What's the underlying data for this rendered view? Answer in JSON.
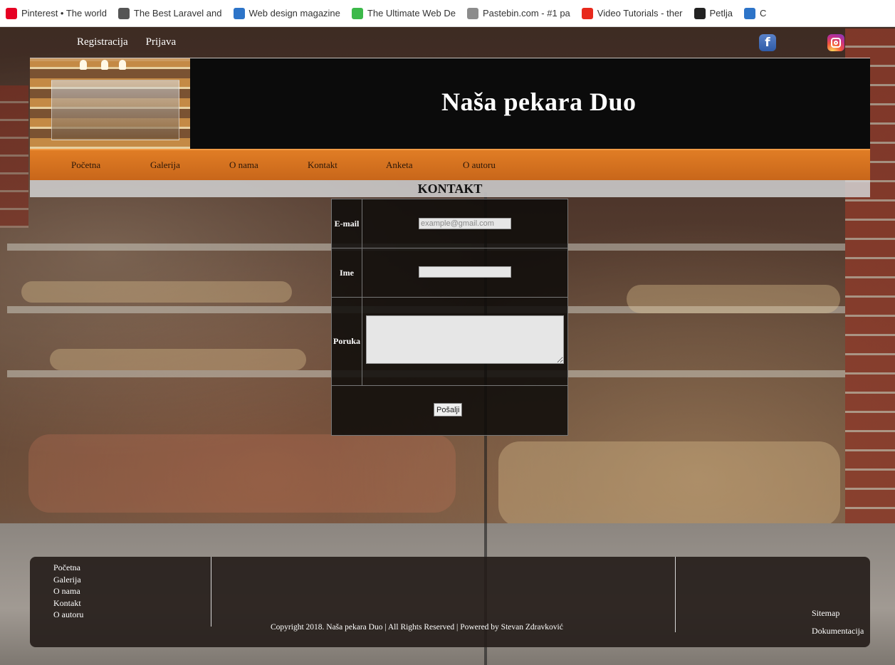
{
  "bookmarks": [
    {
      "label": "Pinterest • The world",
      "icon": "pinterest-icon",
      "color": "#e60023"
    },
    {
      "label": "The Best Laravel and",
      "icon": "laravel-icon",
      "color": "#555555"
    },
    {
      "label": "Web design magazine",
      "icon": "webdesign-icon",
      "color": "#2d74c8"
    },
    {
      "label": "The Ultimate Web De",
      "icon": "udemy-icon",
      "color": "#3cb94a"
    },
    {
      "label": "Pastebin.com - #1 pa",
      "icon": "pastebin-icon",
      "color": "#8c8c8c"
    },
    {
      "label": "Video Tutorials - ther",
      "icon": "video-tutorials-icon",
      "color": "#e8291c"
    },
    {
      "label": "Petlja",
      "icon": "petlja-icon",
      "color": "#222222"
    },
    {
      "label": "C",
      "icon": "bookmark-icon",
      "color": "#2d74c8"
    }
  ],
  "header": {
    "register": "Registracija",
    "login": "Prijava"
  },
  "banner": {
    "title": "Naša pekara Duo"
  },
  "nav": {
    "items": [
      "Početna",
      "Galerija",
      "O nama",
      "Kontakt",
      "Anketa",
      "O autoru"
    ]
  },
  "section": {
    "title": "KONTAKT"
  },
  "form": {
    "email_label": "E-mail",
    "email_placeholder": "example@gmail.com",
    "name_label": "Ime",
    "name_value": "",
    "message_label": "Poruka",
    "submit": "Pošalji"
  },
  "footer": {
    "links": [
      "Početna",
      "Galerija",
      "O nama",
      "Kontakt",
      "O autoru"
    ],
    "copyright": "Copyright 2018. Naša pekara Duo | All Rights Reserved | Powered by Stevan Zdravković",
    "right_links": [
      "Sitemap",
      "Dokumentacija"
    ]
  }
}
